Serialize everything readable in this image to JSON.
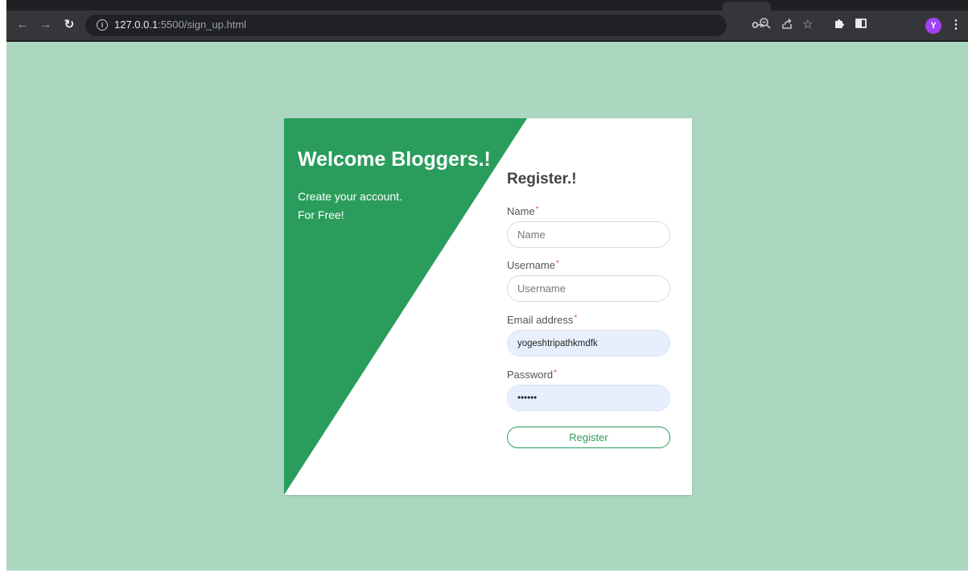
{
  "browser": {
    "url_host": "127.0.0.1",
    "url_rest": ":5500/sign_up.html",
    "icons": [
      "back-arrow-icon",
      "forward-arrow-icon",
      "reload-icon",
      "info-icon",
      "key-icon",
      "zoom-icon",
      "share-icon",
      "star-icon",
      "extensions-icon",
      "side-panel-icon",
      "kebab-menu-icon"
    ],
    "avatar_initial": "Y",
    "avatar_color": "#a142f4"
  },
  "page": {
    "background_color": "#abd7c0",
    "accent_color": "#2a9d5c"
  },
  "hero": {
    "title": "Welcome Bloggers.!",
    "line1": "Create your account.",
    "line2": "For Free!"
  },
  "form": {
    "title": "Register.!",
    "fields": [
      {
        "label": "Name",
        "required_mark": "*",
        "placeholder": "Name",
        "value": ""
      },
      {
        "label": "Username",
        "required_mark": "*",
        "placeholder": "Username",
        "value": ""
      },
      {
        "label": "Email address",
        "required_mark": "*",
        "placeholder": "",
        "value": "yogeshtripathkmdfk"
      },
      {
        "label": "Password",
        "required_mark": "*",
        "placeholder": "",
        "value": "••••••"
      }
    ],
    "submit_label": "Register"
  }
}
